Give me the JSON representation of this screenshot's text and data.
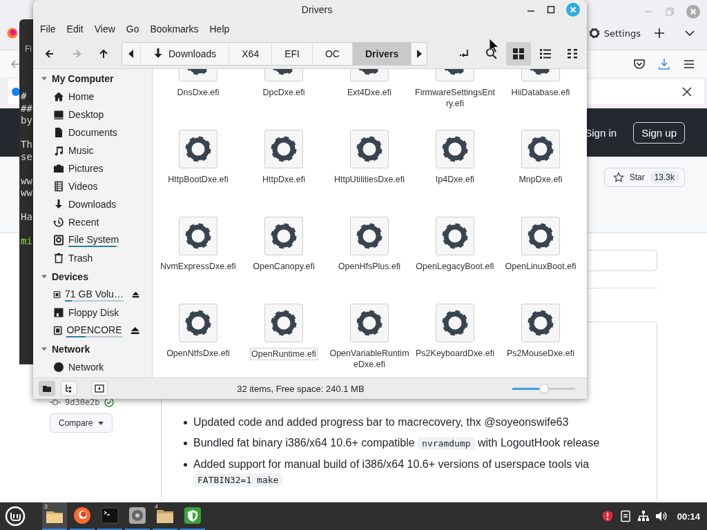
{
  "browser": {
    "tab": {
      "label": "Settings"
    },
    "header": {
      "sign_in": "Sign in",
      "sign_up": "Sign up"
    },
    "star": {
      "label": "Star",
      "count": "13.3k"
    },
    "commit": {
      "hash": "9d30e2b"
    },
    "compare": "Compare",
    "notes": [
      {
        "segments": [
          {
            "kind": "plain",
            "text": "Updated code and added progress bar to macrecovery, thx @soyeonswife63"
          }
        ]
      },
      {
        "segments": [
          {
            "kind": "plain",
            "text": "Bundled fat binary i386/x64 10.6+ compatible "
          },
          {
            "kind": "code",
            "text": "nvramdump"
          },
          {
            "kind": "plain",
            "text": " with LogoutHook release"
          }
        ]
      },
      {
        "segments": [
          {
            "kind": "plain",
            "text": "Added support for manual build of i386/x64 10.6+ versions of userspace tools via "
          },
          {
            "kind": "code",
            "text": "FATBIN32=1 make"
          }
        ]
      }
    ]
  },
  "terminal": {
    "title": "Fi",
    "paragraphs": [
      {
        "kind": "text",
        "lines": [
          "#",
          "##",
          "by"
        ]
      },
      {
        "kind": "text",
        "lines": [
          "Th",
          "se"
        ]
      },
      {
        "kind": "text",
        "lines": [
          "ww",
          "ww"
        ]
      },
      {
        "kind": "text",
        "lines": [
          "Ha"
        ]
      },
      {
        "kind": "prompt",
        "lines": [
          "mi"
        ]
      }
    ]
  },
  "file_manager": {
    "title": "Drivers",
    "menu": [
      "File",
      "Edit",
      "View",
      "Go",
      "Bookmarks",
      "Help"
    ],
    "nav": [
      {
        "kind": "back",
        "disabled": false
      },
      {
        "kind": "forward",
        "disabled": true
      },
      {
        "kind": "up",
        "disabled": false
      }
    ],
    "breadcrumb": [
      {
        "label": "Downloads",
        "kind": "downloads",
        "selected": false
      },
      {
        "label": "X64",
        "kind": "folder",
        "selected": false
      },
      {
        "label": "EFI",
        "kind": "folder",
        "selected": false
      },
      {
        "label": "OC",
        "kind": "folder",
        "selected": false
      },
      {
        "label": "Drivers",
        "kind": "folder",
        "selected": true
      }
    ],
    "tools": [
      {
        "kind": "location",
        "selected": false
      },
      {
        "kind": "search",
        "selected": false
      },
      {
        "kind": "grid",
        "selected": true
      },
      {
        "kind": "list",
        "selected": false
      },
      {
        "kind": "compact",
        "selected": false
      }
    ],
    "sidebar": [
      {
        "title": "My Computer",
        "expanded": true,
        "items": [
          {
            "label": "Home",
            "kind": "home"
          },
          {
            "label": "Desktop",
            "kind": "desktop"
          },
          {
            "label": "Documents",
            "kind": "document"
          },
          {
            "label": "Music",
            "kind": "music"
          },
          {
            "label": "Pictures",
            "kind": "camera"
          },
          {
            "label": "Videos",
            "kind": "film"
          },
          {
            "label": "Downloads",
            "kind": "download"
          },
          {
            "label": "Recent",
            "kind": "recent"
          },
          {
            "label": "File System",
            "kind": "filesystem",
            "level": 0.95
          },
          {
            "label": "Trash",
            "kind": "trash"
          }
        ]
      },
      {
        "title": "Devices",
        "expanded": true,
        "items": [
          {
            "label": "71 GB Volu…",
            "kind": "drive",
            "level": 0.12,
            "eject": true
          },
          {
            "label": "Floppy Disk",
            "kind": "floppy"
          },
          {
            "label": "OPENCORE",
            "kind": "drive",
            "level": 0.35,
            "eject": true
          }
        ]
      },
      {
        "title": "Network",
        "expanded": true,
        "items": [
          {
            "label": "Network",
            "kind": "network"
          }
        ]
      }
    ],
    "files": [
      {
        "name": "DnsDxe.efi",
        "focused": false
      },
      {
        "name": "DpcDxe.efi",
        "focused": false
      },
      {
        "name": "Ext4Dxe.efi",
        "focused": false
      },
      {
        "name": "FirmwareSettingsEntry.efi",
        "focused": false
      },
      {
        "name": "HiiDatabase.efi",
        "focused": false
      },
      {
        "name": "HttpBootDxe.efi",
        "focused": false
      },
      {
        "name": "HttpDxe.efi",
        "focused": false
      },
      {
        "name": "HttpUtilitiesDxe.efi",
        "focused": false
      },
      {
        "name": "Ip4Dxe.efi",
        "focused": false
      },
      {
        "name": "MnpDxe.efi",
        "focused": false
      },
      {
        "name": "NvmExpressDxe.efi",
        "focused": false
      },
      {
        "name": "OpenCanopy.efi",
        "focused": false
      },
      {
        "name": "OpenHfsPlus.efi",
        "focused": false
      },
      {
        "name": "OpenLegacyBoot.efi",
        "focused": false
      },
      {
        "name": "OpenLinuxBoot.efi",
        "focused": false
      },
      {
        "name": "OpenNtfsDxe.efi",
        "focused": false
      },
      {
        "name": "OpenRuntime.efi",
        "focused": true
      },
      {
        "name": "OpenVariableRuntimeDxe.efi",
        "focused": false
      },
      {
        "name": "Ps2KeyboardDxe.efi",
        "focused": false
      },
      {
        "name": "Ps2MouseDxe.efi",
        "focused": false
      }
    ],
    "status_bar": {
      "panes": [
        {
          "kind": "places",
          "selected": true
        },
        {
          "kind": "tree",
          "selected": false
        },
        {
          "kind": "sidebar",
          "selected": false
        }
      ],
      "text": "32 items, Free space: 240.1 MB",
      "zoom": {
        "level": 0.5
      }
    }
  },
  "taskbar": {
    "apps": [
      {
        "kind": "files",
        "count": "3",
        "active": true
      },
      {
        "kind": "firefox",
        "active": false
      },
      {
        "kind": "terminal",
        "active": false
      },
      {
        "kind": "disks",
        "active": false
      },
      {
        "kind": "folder",
        "count": "4",
        "active": false
      },
      {
        "kind": "shield",
        "active": false
      }
    ],
    "tray": [
      {
        "kind": "shield"
      },
      {
        "kind": "notes"
      },
      {
        "kind": "network"
      },
      {
        "kind": "volume"
      }
    ],
    "clock": "00:14"
  }
}
